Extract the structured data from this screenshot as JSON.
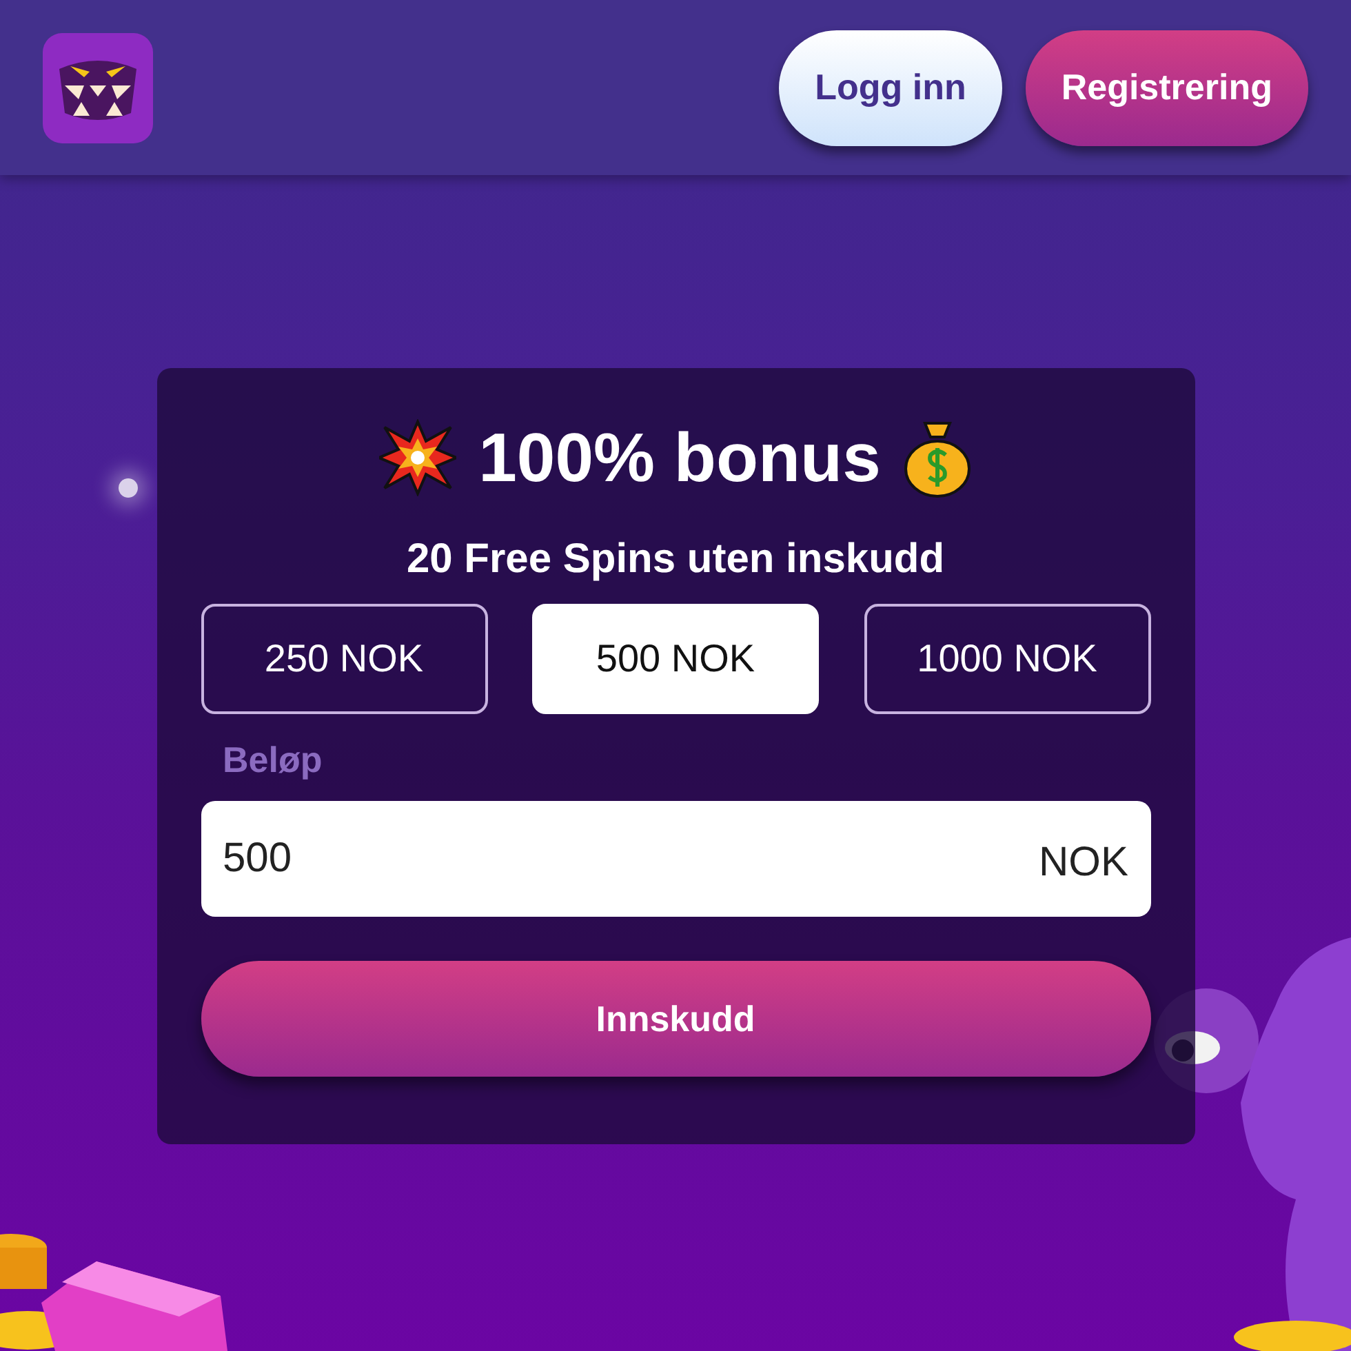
{
  "header": {
    "login_button": "Logg inn",
    "register_button": "Registrering"
  },
  "bonus_card": {
    "title": "100% bonus",
    "subtitle": "20 Free Spins uten inskudd",
    "amount_options": [
      {
        "label": "250 NOK",
        "selected": false
      },
      {
        "label": "500 NOK",
        "selected": true
      },
      {
        "label": "1000 NOK",
        "selected": false
      }
    ],
    "amount_label": "Beløp",
    "amount_field": {
      "value": "500",
      "currency": "NOK"
    },
    "deposit_button": "Innskudd"
  }
}
